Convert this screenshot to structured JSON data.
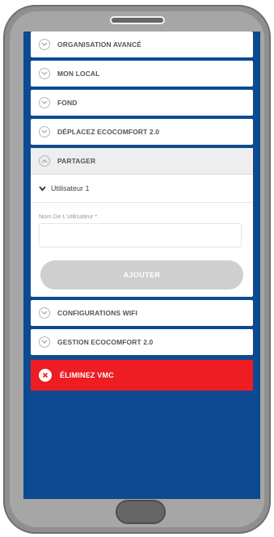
{
  "menu": {
    "items": [
      {
        "label": "ORGANISATION AVANCÉ"
      },
      {
        "label": "MON LOCAL"
      },
      {
        "label": "FOND"
      },
      {
        "label": "DÉPLACEZ ECOCOMFORT 2.0"
      }
    ],
    "expanded": {
      "label": "PARTAGER",
      "user_label": "Utilisateur 1",
      "field_label": "Nom De L'utilisateur *",
      "field_value": "",
      "add_button": "AJOUTER"
    },
    "items_after": [
      {
        "label": "CONFIGURATIONS WIFI"
      },
      {
        "label": "GESTION ECOCOMFORT 2.0"
      }
    ],
    "remove_label": "ÉLIMINEZ VMC"
  },
  "colors": {
    "screen_bg": "#0d4a91",
    "remove_bg": "#ee1c23",
    "phone_frame": "#8f8f8f",
    "button_disabled": "#cfcfcf"
  }
}
